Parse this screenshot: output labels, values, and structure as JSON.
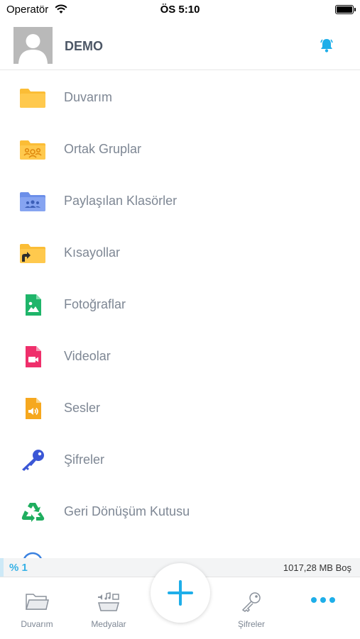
{
  "status_bar": {
    "carrier": "Operatör",
    "time": "ÖS 5:10"
  },
  "header": {
    "user_name": "DEMO"
  },
  "menu": [
    {
      "label": "Duvarım",
      "icon": "folder-icon"
    },
    {
      "label": "Ortak Gruplar",
      "icon": "group-folder-icon"
    },
    {
      "label": "Paylaşılan Klasörler",
      "icon": "shared-folder-icon"
    },
    {
      "label": "Kısayollar",
      "icon": "shortcut-folder-icon"
    },
    {
      "label": "Fotoğraflar",
      "icon": "photo-file-icon"
    },
    {
      "label": "Videolar",
      "icon": "video-file-icon"
    },
    {
      "label": "Sesler",
      "icon": "audio-file-icon"
    },
    {
      "label": "Şifreler",
      "icon": "key-icon"
    },
    {
      "label": "Geri Dönüşüm Kutusu",
      "icon": "recycle-icon"
    }
  ],
  "storage": {
    "usage_percent": "% 1",
    "usage_fraction": 0.01,
    "free_space": "1017,28 MB Boş"
  },
  "tabbar": {
    "tabs": [
      {
        "label": "Duvarım",
        "icon": "folder-outline-icon"
      },
      {
        "label": "Medyalar",
        "icon": "media-icon"
      },
      {
        "label": "Şifreler",
        "icon": "key-outline-icon"
      }
    ],
    "add_icon": "plus-icon",
    "more_icon": "more-dots-icon"
  },
  "colors": {
    "accent": "#1eaee9",
    "folder": "#fbbd36",
    "shared_folder": "#6c8fe9",
    "photo": "#1fb56a",
    "video": "#ef2f6b",
    "key": "#3b57d6",
    "recycle": "#1fae5f"
  }
}
